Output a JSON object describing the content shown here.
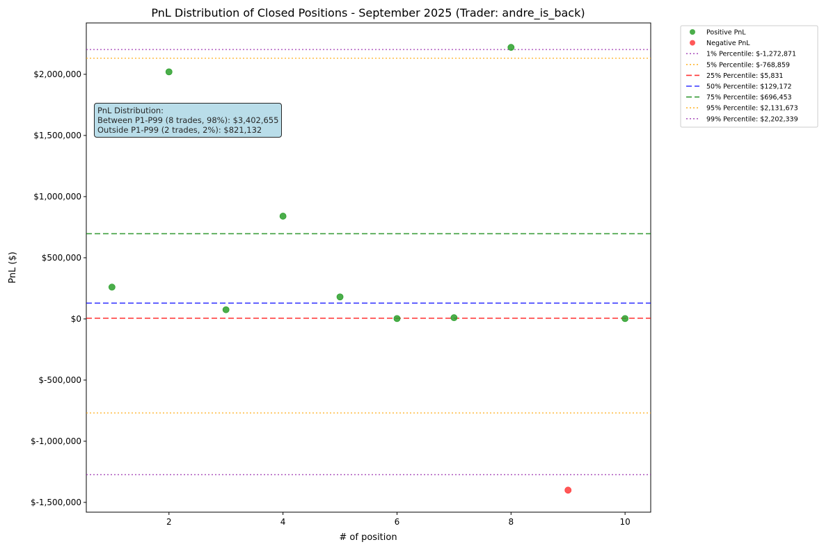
{
  "chart_data": {
    "type": "scatter",
    "title": "PnL Distribution of Closed Positions - September 2025 (Trader: andre_is_back)",
    "xlabel": "# of position",
    "ylabel": "PnL ($)",
    "xlim": [
      0.55,
      10.45
    ],
    "ylim": [
      -1580000,
      2420000
    ],
    "x_ticks": [
      2,
      4,
      6,
      8,
      10
    ],
    "x_tick_labels": [
      "2",
      "4",
      "6",
      "8",
      "10"
    ],
    "y_ticks": [
      -1500000,
      -1000000,
      -500000,
      0,
      500000,
      1000000,
      1500000,
      2000000
    ],
    "y_tick_labels": [
      "$-1,500,000",
      "$-1,000,000",
      "$-500,000",
      "$0",
      "$500,000",
      "$1,000,000",
      "$1,500,000",
      "$2,000,000"
    ],
    "grid": false,
    "legend_position": "outside-top-right",
    "series": [
      {
        "name": "Positive PnL",
        "color": "#2ca02c",
        "points": [
          {
            "x": 1,
            "y": 260000
          },
          {
            "x": 2,
            "y": 2020000
          },
          {
            "x": 3,
            "y": 75000
          },
          {
            "x": 4,
            "y": 840000
          },
          {
            "x": 5,
            "y": 180000
          },
          {
            "x": 6,
            "y": 3000
          },
          {
            "x": 7,
            "y": 10000
          },
          {
            "x": 8,
            "y": 2220000
          },
          {
            "x": 10,
            "y": 3000
          }
        ]
      },
      {
        "name": "Negative PnL",
        "color": "#ff3b3b",
        "points": [
          {
            "x": 9,
            "y": -1400000
          }
        ]
      }
    ],
    "reference_lines": [
      {
        "label": "1% Percentile: $-1,272,871",
        "value": -1272871,
        "color": "#9b30b0",
        "style": "dotted"
      },
      {
        "label": "5% Percentile: $-768,859",
        "value": -768859,
        "color": "#ffa500",
        "style": "dotted"
      },
      {
        "label": "25% Percentile: $5,831",
        "value": 5831,
        "color": "#ff0000",
        "style": "dashed"
      },
      {
        "label": "50% Percentile: $129,172",
        "value": 129172,
        "color": "#0000ff",
        "style": "dashed"
      },
      {
        "label": "75% Percentile: $696,453",
        "value": 696453,
        "color": "#008000",
        "style": "dashed"
      },
      {
        "label": "95% Percentile: $2,131,673",
        "value": 2131673,
        "color": "#ffa500",
        "style": "dotted"
      },
      {
        "label": "99% Percentile: $2,202,339",
        "value": 2202339,
        "color": "#9b30b0",
        "style": "dotted"
      }
    ],
    "annotation": {
      "line1": "PnL Distribution:",
      "line2": "Between P1-P99 (8 trades, 98%): $3,402,655",
      "line3": "Outside P1-P99 (2 trades, 2%): $821,132"
    }
  }
}
